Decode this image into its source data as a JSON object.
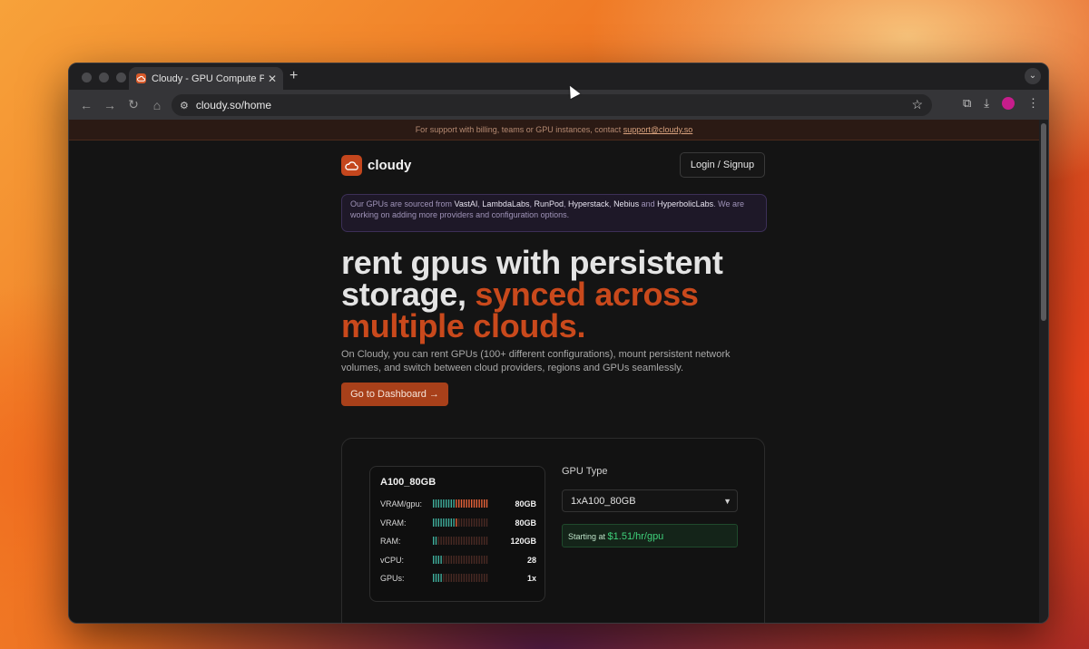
{
  "browser": {
    "tab_title": "Cloudy - GPU Compute Platform",
    "tab_close": "✕",
    "new_tab": "+",
    "url": "cloudy.so/home"
  },
  "banner": {
    "text": "For support with billing, teams or GPU instances, contact ",
    "email": "support@cloudy.so"
  },
  "header": {
    "brand": "cloudy",
    "login_label": "Login / Signup"
  },
  "sources": {
    "prefix": "Our GPUs are sourced from ",
    "providers": [
      "VastAI",
      "LambdaLabs",
      "RunPod",
      "Hyperstack",
      "Nebius",
      "HyperbolicLabs"
    ],
    "sep_comma": ", ",
    "sep_and": " and ",
    "suffix": ". We are working on adding more providers and configuration options."
  },
  "hero": {
    "line1": "rent gpus with persistent",
    "line2": "storage, ",
    "accent": "synced across multiple clouds."
  },
  "description": "On Cloudy, you can rent GPUs (100+ different configurations), mount persistent network volumes, and switch between cloud providers, regions and GPUs seamlessly.",
  "cta_label": "Go to Dashboard →",
  "spec_card": {
    "title": "A100_80GB",
    "rows": [
      {
        "label": "VRAM/gpu:",
        "value": "80GB",
        "level": 1.0
      },
      {
        "label": "VRAM:",
        "value": "80GB",
        "level": 0.45
      },
      {
        "label": "RAM:",
        "value": "120GB",
        "level": 0.1
      },
      {
        "label": "vCPU:",
        "value": "28",
        "level": 0.2
      },
      {
        "label": "GPUs:",
        "value": "1x",
        "level": 0.2
      }
    ]
  },
  "config": {
    "gpu_type_label": "GPU Type",
    "selected": "1xA100_80GB",
    "price_prefix": "Starting at ",
    "price": "$1.51/hr/gpu"
  },
  "colors": {
    "accent": "#c9491c",
    "bar_on": "#3fae9c",
    "bar_hot": "#e8633a",
    "bar_off": "#4a2a24",
    "price_green": "#3fd07a"
  }
}
